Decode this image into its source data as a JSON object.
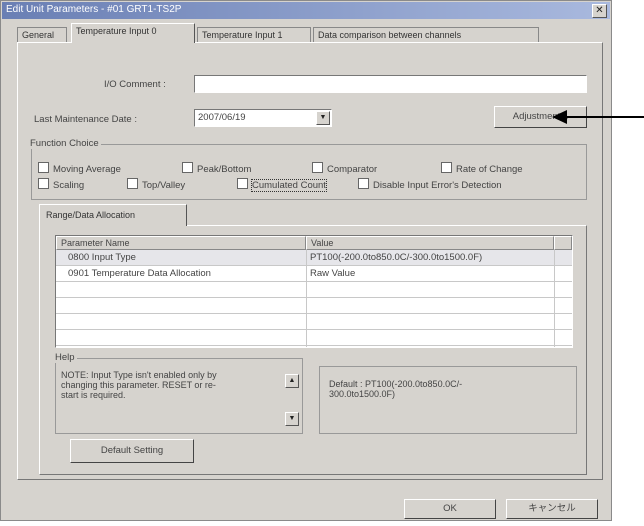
{
  "window": {
    "title": "Edit Unit Parameters - #01 GRT1-TS2P",
    "close_glyph": "✕"
  },
  "tabs": [
    {
      "label": "General"
    },
    {
      "label": "Temperature Input 0"
    },
    {
      "label": "Temperature Input 1"
    },
    {
      "label": "Data comparison between channels"
    }
  ],
  "form": {
    "io_comment_label": "I/O Comment :",
    "io_comment_value": "",
    "last_maintenance_label": "Last Maintenance Date :",
    "last_maintenance_value": "2007/06/19",
    "adjustment_label": "Adjustment..."
  },
  "function_choice": {
    "title": "Function Choice",
    "options": [
      {
        "label": "Moving Average"
      },
      {
        "label": "Peak/Bottom"
      },
      {
        "label": "Comparator"
      },
      {
        "label": "Rate of Change"
      },
      {
        "label": "Scaling"
      },
      {
        "label": "Top/Valley"
      },
      {
        "label": "Cumulated Count"
      },
      {
        "label": "Disable Input Error's Detection"
      }
    ]
  },
  "subtab": {
    "label": "Range/Data Allocation"
  },
  "table": {
    "columns": [
      "Parameter Name",
      "Value"
    ],
    "rows": [
      {
        "name": "0800 Input Type",
        "value": "PT100(-200.0to850.0C/-300.0to1500.0F)"
      },
      {
        "name": "0901 Temperature Data Allocation",
        "value": "Raw Value"
      }
    ]
  },
  "help": {
    "title": "Help",
    "lines": [
      "NOTE: Input Type isn't enabled only by",
      "changing this parameter. RESET or re-",
      "start is required."
    ],
    "default_lines": [
      "Default : PT100(-200.0to850.0C/-",
      "300.0to1500.0F)"
    ]
  },
  "default_setting_label": "Default Setting",
  "footer": {
    "ok_label": "OK",
    "cancel_label": "キャンセル"
  }
}
